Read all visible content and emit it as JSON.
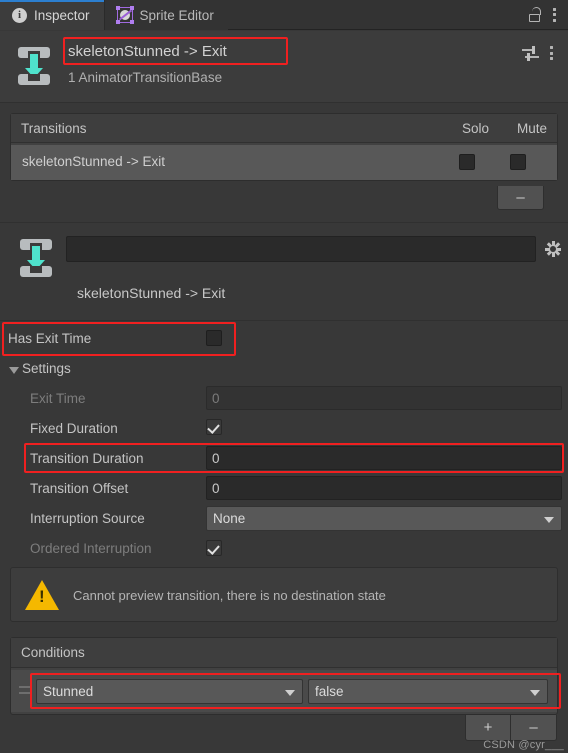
{
  "window": {
    "tabs": [
      {
        "label": "Inspector",
        "icon": "info-icon",
        "active": true
      },
      {
        "label": "Sprite Editor",
        "icon": "sprite-editor-icon",
        "active": false
      }
    ],
    "lock_icon": "lock-open-icon",
    "menu_icon": "kebab-menu-icon"
  },
  "object_header": {
    "icon": "animator-transition-icon",
    "title": "skeletonStunned -> Exit",
    "subtitle": "1 AnimatorTransitionBase",
    "preset_icon": "preset-sliders-icon",
    "menu_icon": "kebab-menu-icon"
  },
  "transitions_panel": {
    "header_label": "Transitions",
    "solo_label": "Solo",
    "mute_label": "Mute",
    "rows": [
      {
        "label": "skeletonStunned -> Exit",
        "solo": false,
        "mute": false
      }
    ],
    "remove_button_label": "–"
  },
  "transition_editor": {
    "icon": "animator-transition-icon",
    "name_field_value": "",
    "name_field_placeholder": "",
    "gear_icon": "gear-icon",
    "caption": "skeletonStunned -> Exit"
  },
  "settings": {
    "has_exit_time": {
      "label": "Has Exit Time",
      "checked": false
    },
    "foldout_label": "Settings",
    "foldout_expanded": true,
    "rows": [
      {
        "label": "Exit Time",
        "type": "number",
        "value": "0",
        "disabled": true
      },
      {
        "label": "Fixed Duration",
        "type": "checkbox",
        "checked": true,
        "disabled": false
      },
      {
        "label": "Transition Duration",
        "type": "number",
        "value": "0",
        "disabled": false
      },
      {
        "label": "Transition Offset",
        "type": "number",
        "value": "0",
        "disabled": false
      },
      {
        "label": "Interruption Source",
        "type": "dropdown",
        "value": "None",
        "disabled": false
      },
      {
        "label": "Ordered Interruption",
        "type": "checkbox",
        "checked": true,
        "disabled": true
      }
    ]
  },
  "warning": {
    "icon": "warning-triangle-icon",
    "glyph": "!",
    "text": "Cannot preview transition, there is no destination state"
  },
  "conditions": {
    "header_label": "Conditions",
    "rows": [
      {
        "drag_handle": "drag-handle-icon",
        "parameter": "Stunned",
        "comparison": "false"
      }
    ],
    "add_button_label": "+",
    "remove_button_label": "–"
  },
  "watermark": "CSDN @cyr___",
  "colors": {
    "accent_tab": "#2c7fd0",
    "arrow_cyan": "#4fe3cd",
    "warning_yellow": "#f5b800",
    "annotation_red": "#f02020",
    "panel_bg": "#414141",
    "window_bg": "#383838"
  }
}
